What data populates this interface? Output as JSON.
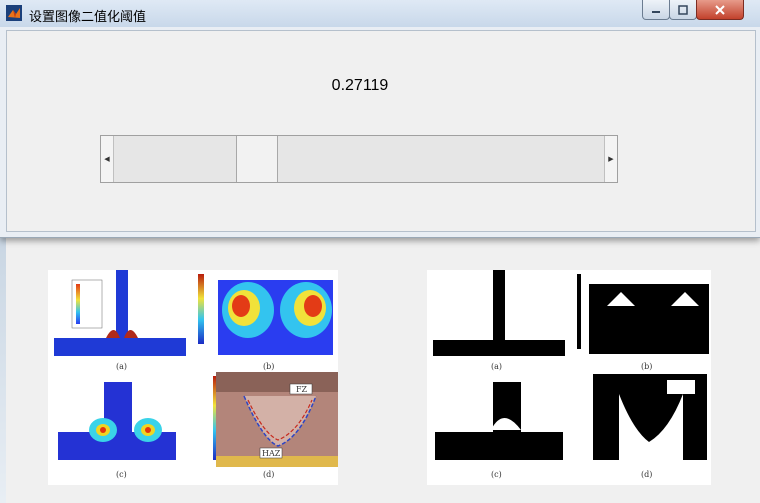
{
  "dialog": {
    "title": "设置图像二值化阈值",
    "threshold_value": "0.27119",
    "threshold_fraction": 0.27119
  },
  "background_window": {
    "title_fragment": "图像",
    "figure_left": {
      "labels": [
        "(a)",
        "(b)",
        "(c)",
        "(d)"
      ],
      "annotations": [
        "FZ",
        "HAZ"
      ]
    },
    "figure_right": {
      "labels": [
        "(a)",
        "(b)",
        "(c)",
        "(d)"
      ]
    }
  },
  "colors": {
    "title_bar": "#c8d8ea",
    "close_button": "#c2412c",
    "dialog_bg": "#f0f0f0"
  },
  "icons": [
    "matlab-icon",
    "minimize-icon",
    "maximize-icon",
    "close-icon",
    "arrow-left-icon",
    "arrow-right-icon"
  ]
}
